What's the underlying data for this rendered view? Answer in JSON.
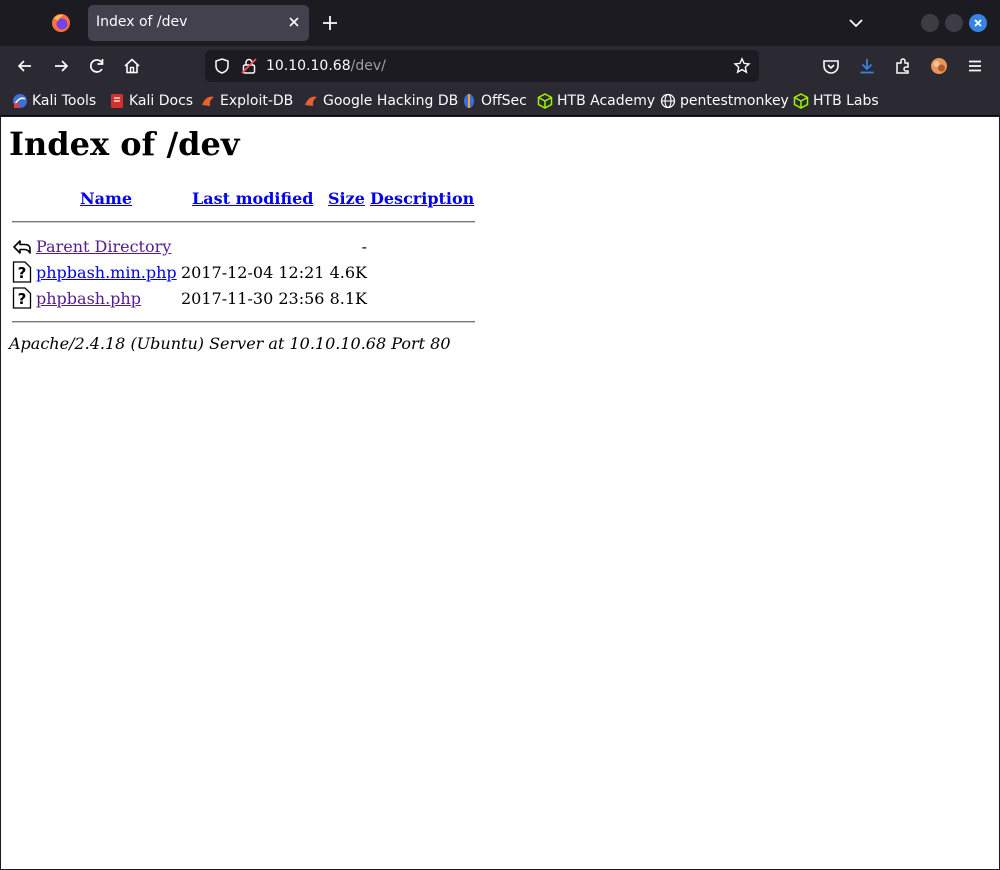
{
  "browser": {
    "tab_title": "Index of /dev",
    "url_host": "10.10.10.68",
    "url_path": "/dev/",
    "bookmarks": [
      {
        "label": "Kali Tools",
        "icon": "kali-tools-icon"
      },
      {
        "label": "Kali Docs",
        "icon": "kali-docs-icon"
      },
      {
        "label": "Exploit-DB",
        "icon": "exploit-db-icon"
      },
      {
        "label": "Google Hacking DB",
        "icon": "ghdb-icon"
      },
      {
        "label": "OffSec",
        "icon": "offsec-icon"
      },
      {
        "label": "HTB Academy",
        "icon": "htb-academy-icon"
      },
      {
        "label": "pentestmonkey",
        "icon": "globe-icon"
      },
      {
        "label": "HTB Labs",
        "icon": "htb-labs-icon"
      }
    ],
    "colors": {
      "chrome_dark": "#1c1b22",
      "toolbar": "#2b2a33",
      "tab_active": "#42414d",
      "accent": "#3584e4"
    }
  },
  "page": {
    "heading": "Index of /dev",
    "columns": {
      "name": "Name",
      "modified": "Last modified",
      "size": "Size",
      "description": "Description"
    },
    "rows": [
      {
        "name": "Parent Directory",
        "modified": "",
        "size": "-",
        "icon": "back-arrow-icon"
      },
      {
        "name": "phpbash.min.php",
        "modified": "2017-12-04 12:21",
        "size": "4.6K",
        "icon": "unknown-file-icon"
      },
      {
        "name": "phpbash.php",
        "modified": "2017-11-30 23:56",
        "size": "8.1K",
        "icon": "unknown-file-icon"
      }
    ],
    "address": "Apache/2.4.18 (Ubuntu) Server at 10.10.10.68 Port 80"
  }
}
